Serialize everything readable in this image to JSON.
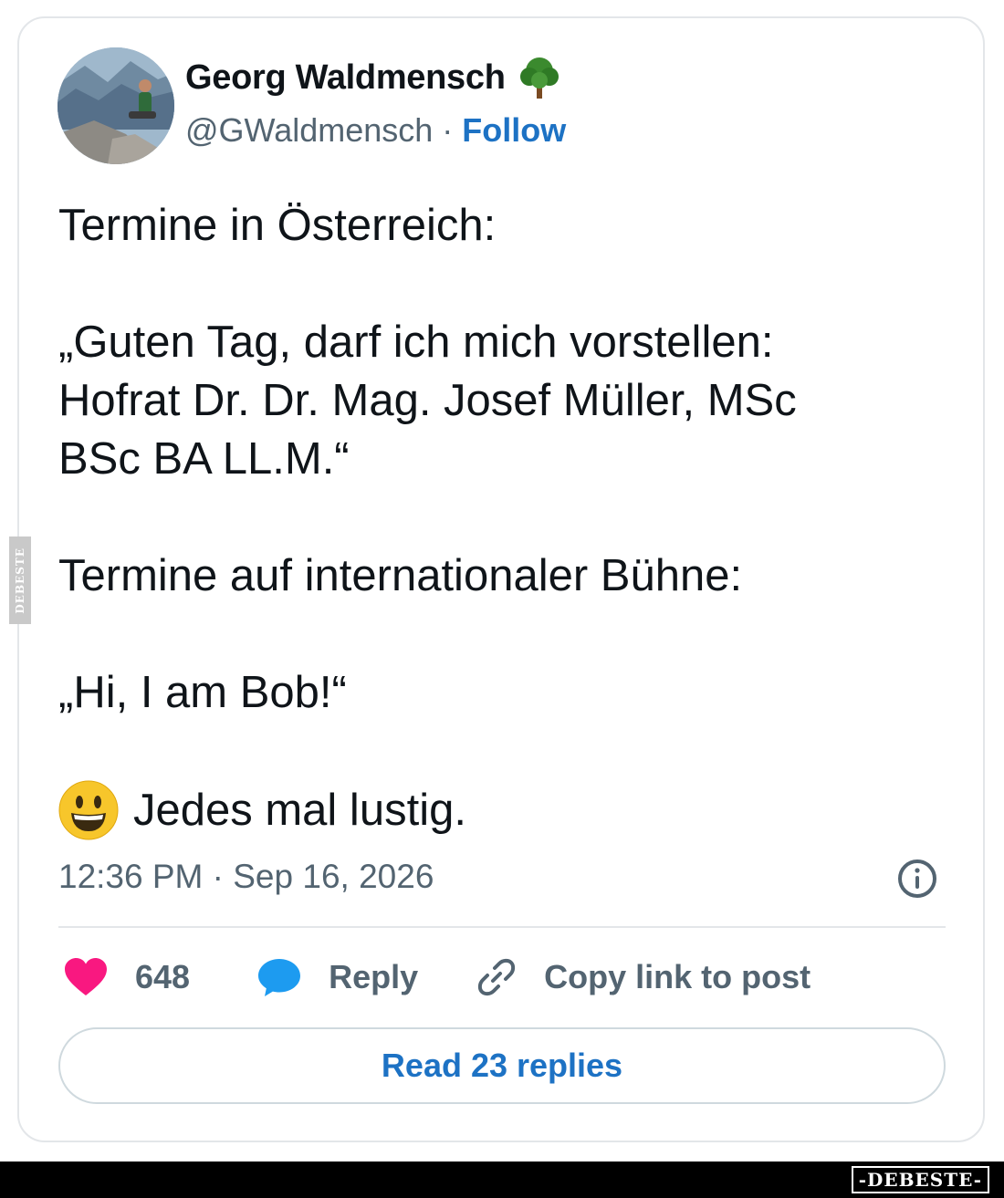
{
  "author": {
    "name": "Georg Waldmensch",
    "handle": "@GWaldmensch",
    "separator": "·",
    "follow_label": "Follow",
    "badge_icon": "deciduous-tree-icon"
  },
  "tweet": {
    "line1": "Termine in Österreich:",
    "line2": "„Guten Tag, darf ich mich vorstellen:",
    "line3": "Hofrat Dr. Dr. Mag. Josef Müller, MSc",
    "line4": "BSc BA LL.M.“",
    "line5": "Termine auf internationaler Bühne:",
    "line6": "„Hi, I am Bob!“",
    "line7": "Jedes mal lustig.",
    "emoji_icon": "smiley-icon"
  },
  "meta": {
    "timestamp": "12:36 PM · Sep 16, 2026"
  },
  "actions": {
    "likes_count": "648",
    "reply_label": "Reply",
    "copy_label": "Copy link to post",
    "read_replies_label": "Read 23 replies"
  },
  "watermark": {
    "side_text": "DEBESTE",
    "brand_text": "-DEBESTE-"
  },
  "colors": {
    "link": "#1d72c4",
    "heart": "#f91880",
    "reply_bubble": "#1d9bf0",
    "muted": "#536471"
  }
}
